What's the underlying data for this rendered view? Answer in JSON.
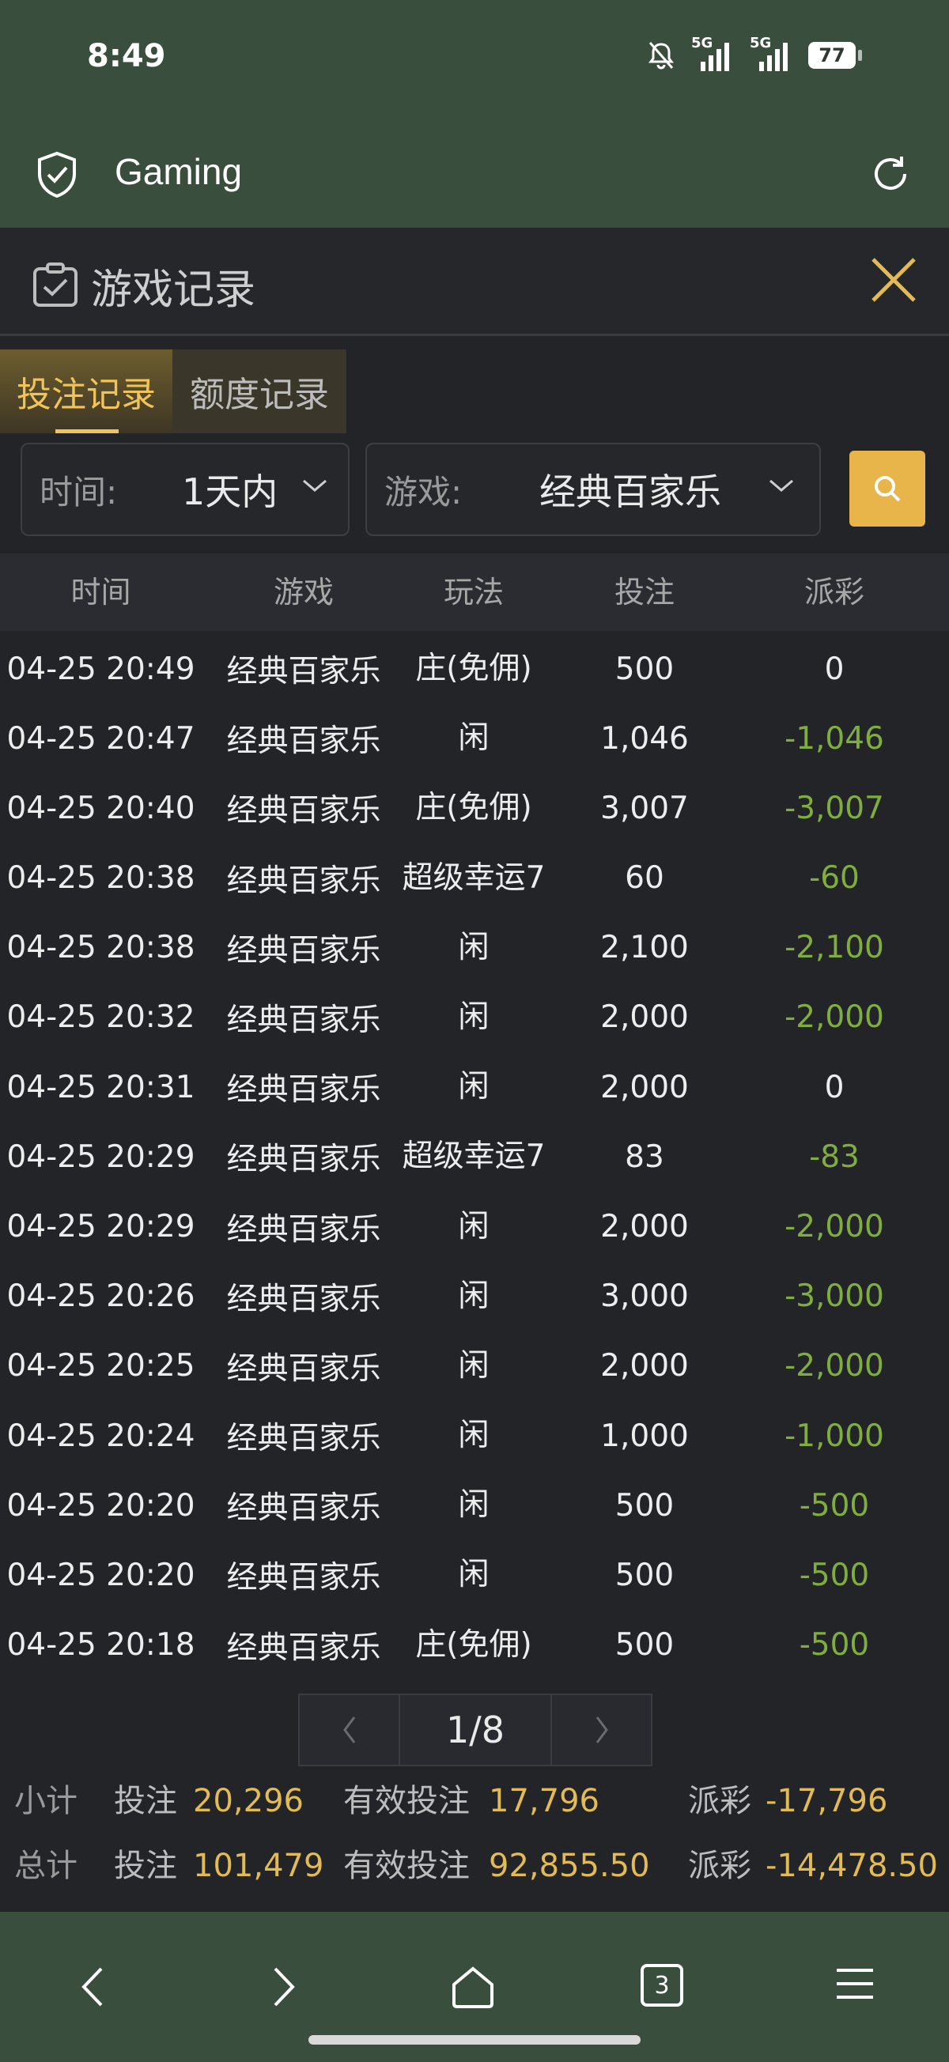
{
  "status": {
    "time": "8:49",
    "battery": "77",
    "signal_label": "5G"
  },
  "app": {
    "title": "Gaming"
  },
  "modal": {
    "title": "游戏记录"
  },
  "tabs": [
    {
      "label": "投注记录",
      "active": true
    },
    {
      "label": "额度记录",
      "active": false
    }
  ],
  "filters": {
    "time": {
      "label": "时间:",
      "value": "1天内"
    },
    "game": {
      "label": "游戏:",
      "value": "经典百家乐"
    }
  },
  "columns": [
    "时间",
    "游戏",
    "玩法",
    "投注",
    "派彩"
  ],
  "rows": [
    {
      "time": "04-25 20:49",
      "game": "经典百家乐",
      "play": "庄(免佣)",
      "bet": "500",
      "payout": "0"
    },
    {
      "time": "04-25 20:47",
      "game": "经典百家乐",
      "play": "闲",
      "bet": "1,046",
      "payout": "-1,046"
    },
    {
      "time": "04-25 20:40",
      "game": "经典百家乐",
      "play": "庄(免佣)",
      "bet": "3,007",
      "payout": "-3,007"
    },
    {
      "time": "04-25 20:38",
      "game": "经典百家乐",
      "play": "超级幸运7",
      "bet": "60",
      "payout": "-60"
    },
    {
      "time": "04-25 20:38",
      "game": "经典百家乐",
      "play": "闲",
      "bet": "2,100",
      "payout": "-2,100"
    },
    {
      "time": "04-25 20:32",
      "game": "经典百家乐",
      "play": "闲",
      "bet": "2,000",
      "payout": "-2,000"
    },
    {
      "time": "04-25 20:31",
      "game": "经典百家乐",
      "play": "闲",
      "bet": "2,000",
      "payout": "0"
    },
    {
      "time": "04-25 20:29",
      "game": "经典百家乐",
      "play": "超级幸运7",
      "bet": "83",
      "payout": "-83"
    },
    {
      "time": "04-25 20:29",
      "game": "经典百家乐",
      "play": "闲",
      "bet": "2,000",
      "payout": "-2,000"
    },
    {
      "time": "04-25 20:26",
      "game": "经典百家乐",
      "play": "闲",
      "bet": "3,000",
      "payout": "-3,000"
    },
    {
      "time": "04-25 20:25",
      "game": "经典百家乐",
      "play": "闲",
      "bet": "2,000",
      "payout": "-2,000"
    },
    {
      "time": "04-25 20:24",
      "game": "经典百家乐",
      "play": "闲",
      "bet": "1,000",
      "payout": "-1,000"
    },
    {
      "time": "04-25 20:20",
      "game": "经典百家乐",
      "play": "闲",
      "bet": "500",
      "payout": "-500"
    },
    {
      "time": "04-25 20:20",
      "game": "经典百家乐",
      "play": "闲",
      "bet": "500",
      "payout": "-500"
    },
    {
      "time": "04-25 20:18",
      "game": "经典百家乐",
      "play": "庄(免佣)",
      "bet": "500",
      "payout": "-500"
    }
  ],
  "pagination": {
    "label": "1/8"
  },
  "subtotal": {
    "label": "小计",
    "bet_label": "投注",
    "bet": "20,296",
    "valid_label": "有效投注",
    "valid": "17,796",
    "payout_label": "派彩",
    "payout": "-17,796"
  },
  "total": {
    "label": "总计",
    "bet_label": "投注",
    "bet": "101,479",
    "valid_label": "有效投注",
    "valid": "92,855.50",
    "payout_label": "派彩",
    "payout": "-14,478.50"
  },
  "tab_count": "3",
  "colors": {
    "accent": "#e7b54a",
    "negative": "#7fae3e",
    "chrome": "#3a4e3d"
  }
}
